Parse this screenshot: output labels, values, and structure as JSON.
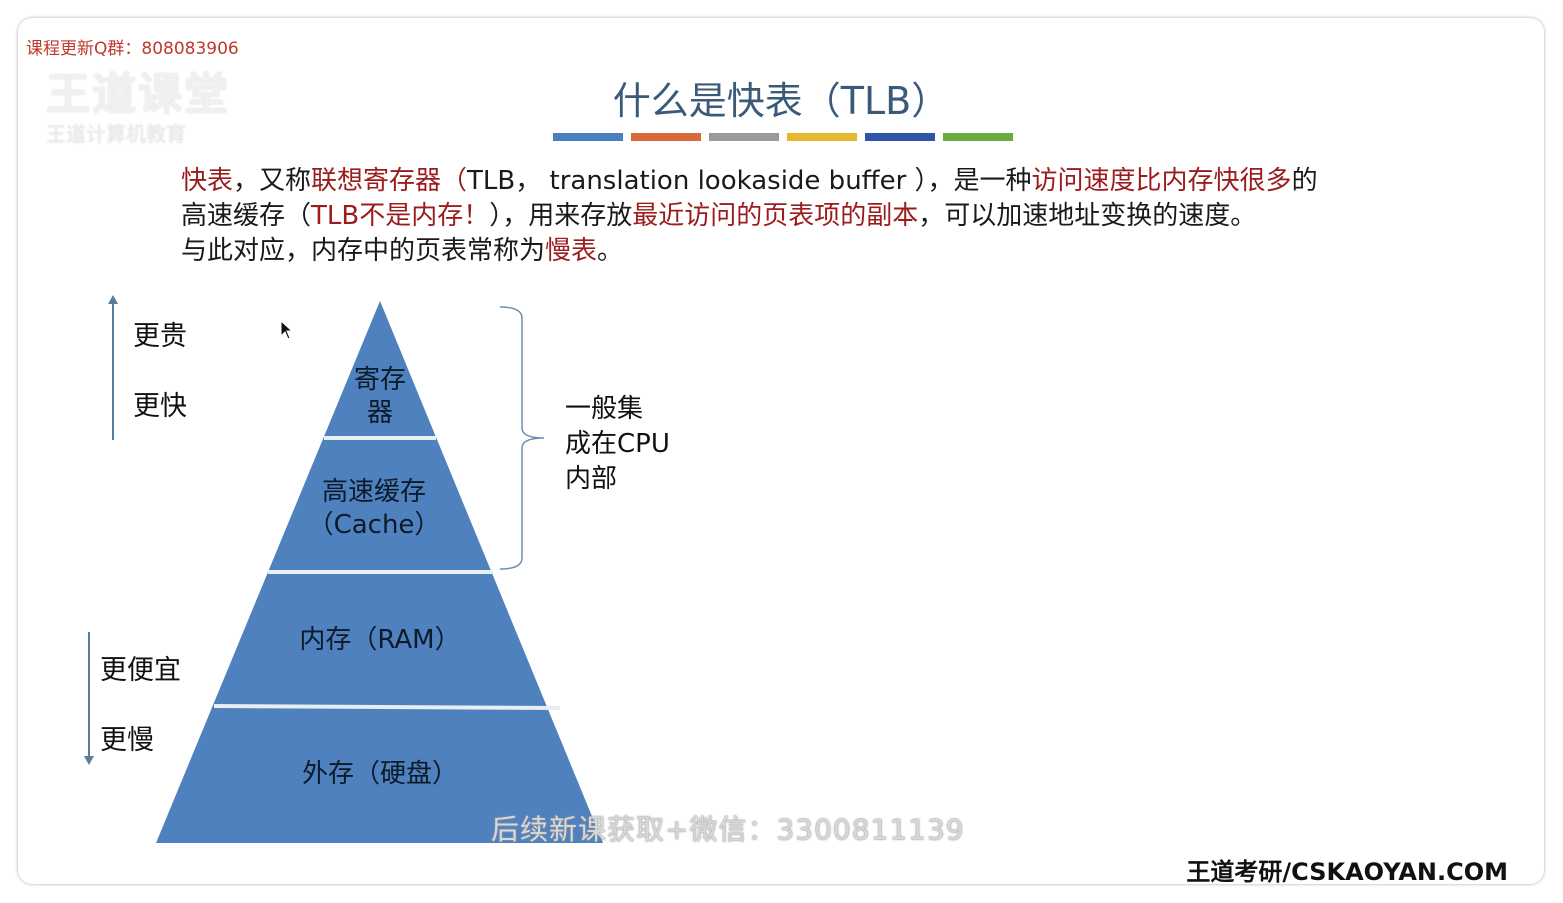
{
  "watermark_top": "课程更新Q群：808083906",
  "logo_ghost": "王道课堂",
  "logo_ghost_sub": "王道计算机教育",
  "title": "什么是快表（TLB）",
  "title_bar_colors": [
    "#4a7fc0",
    "#d86a3a",
    "#9a9a9a",
    "#e6b82e",
    "#2d56a8",
    "#6aab3e"
  ],
  "paragraph": {
    "line1": {
      "a": "快表",
      "b": "，又称",
      "c": "联想寄存器（",
      "d": "TLB， translation lookaside buffer ），是一种",
      "e": "访问速度比内存快很多",
      "f": "的"
    },
    "line2": {
      "a": "高速缓存（",
      "b": "TLB不是内存！",
      "c": "），用来存放",
      "d": "最近访问的页表项的副本",
      "e": "，可以加速地址变换的速度。"
    },
    "line3": {
      "a": "与此对应，内存中的页表常称为",
      "b": "慢表",
      "c": "。"
    }
  },
  "left_labels": {
    "top1": "更贵",
    "top2": "更快",
    "bottom1": "更便宜",
    "bottom2": "更慢"
  },
  "pyramid": {
    "tier1": [
      "寄存",
      "器"
    ],
    "tier2": [
      "高速缓存",
      "（Cache）"
    ],
    "tier3": "内存（RAM）",
    "tier4": "外存（硬盘）",
    "fill_color": "#4e81bd"
  },
  "brace_label": [
    "一般集",
    "成在CPU",
    "内部"
  ],
  "watermark_bottom": "后续新课获取+微信：3300811139",
  "footer": "王道考研/CSKAOYAN.COM"
}
